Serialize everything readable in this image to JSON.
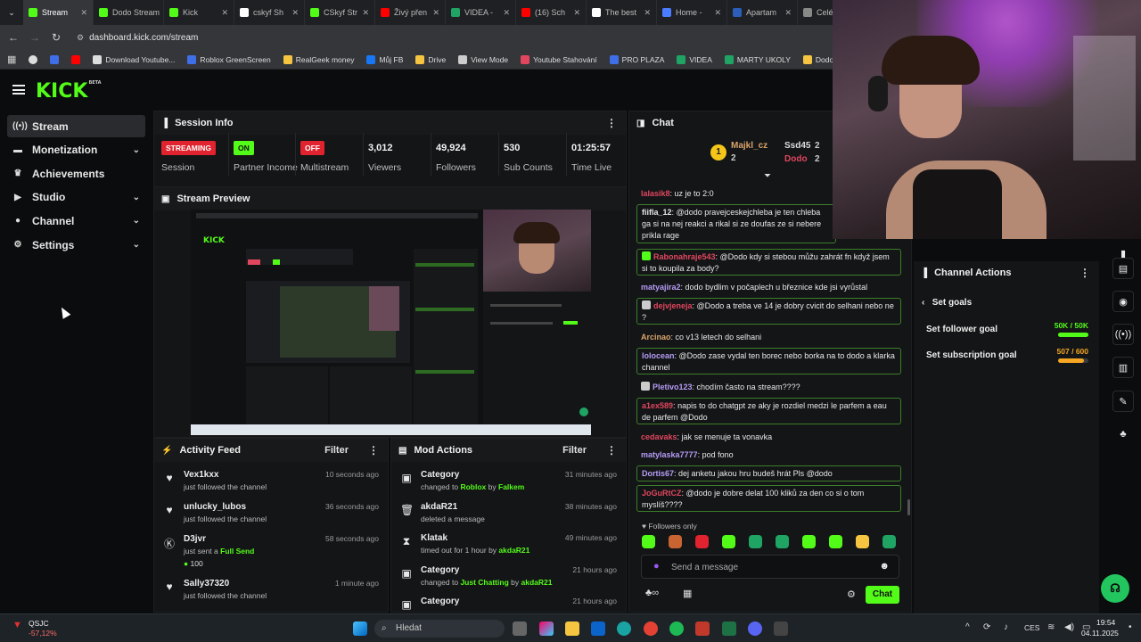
{
  "browser": {
    "tabs": [
      {
        "label": "Stream",
        "color": "#53fc18",
        "active": true
      },
      {
        "label": "Dodo Stream",
        "color": "#53fc18"
      },
      {
        "label": "Kick",
        "color": "#53fc18"
      },
      {
        "label": "cskyf Sh",
        "color": "#ffffff"
      },
      {
        "label": "CSkyf Str",
        "color": "#53fc18"
      },
      {
        "label": "Živý přen",
        "color": "#ff0000"
      },
      {
        "label": "VIDEA -",
        "color": "#1fa463"
      },
      {
        "label": "(16) Sch",
        "color": "#ff0000"
      },
      {
        "label": "The best",
        "color": "#ffffff"
      },
      {
        "label": "Home -",
        "color": "#4a7cff"
      },
      {
        "label": "Apartam",
        "color": "#2b5eb8"
      },
      {
        "label": "Celé",
        "color": "#888888"
      }
    ],
    "url": "dashboard.kick.com/stream",
    "bookmarks": [
      "Download Youtube...",
      "Roblox GreenScreen",
      "RealGeek money",
      "Můj FB",
      "Drive",
      "View Mode",
      "Youtube Stahování",
      "PRO PLAZA",
      "VIDEA",
      "MARTY UKOLY",
      "Dodo videa"
    ]
  },
  "brand": {
    "logo": "KICK",
    "beta": "BETA"
  },
  "sidebar": {
    "items": [
      {
        "label": "Stream",
        "icon": "radio-icon"
      },
      {
        "label": "Monetization",
        "icon": "wallet-icon"
      },
      {
        "label": "Achievements",
        "icon": "trophy-icon"
      },
      {
        "label": "Studio",
        "icon": "camera-icon"
      },
      {
        "label": "Channel",
        "icon": "user-icon"
      },
      {
        "label": "Settings",
        "icon": "gear-icon"
      }
    ]
  },
  "session_info": {
    "title": "Session Info",
    "stats": [
      {
        "value": "STREAMING",
        "label": "Session"
      },
      {
        "value": "ON",
        "label": "Partner Income"
      },
      {
        "value": "OFF",
        "label": "Multistream"
      },
      {
        "value": "3,012",
        "label": "Viewers"
      },
      {
        "value": "49,924",
        "label": "Followers"
      },
      {
        "value": "530",
        "label": "Sub Counts"
      },
      {
        "value": "01:25:57",
        "label": "Time Live"
      }
    ]
  },
  "stream_preview": {
    "title": "Stream Preview"
  },
  "activity_feed": {
    "title": "Activity Feed",
    "filter": "Filter",
    "items": [
      {
        "name": "Vex1kxx",
        "action": "just followed the channel",
        "time": "10 seconds ago"
      },
      {
        "name": "unlucky_lubos",
        "action": "just followed the channel",
        "time": "36 seconds ago"
      },
      {
        "name": "D3jvr",
        "action": "just sent a",
        "highlight": "Full Send",
        "amount": "100",
        "time": "58 seconds ago"
      },
      {
        "name": "Sally37320",
        "action": "just followed the channel",
        "time": "1 minute ago"
      }
    ]
  },
  "mod_actions": {
    "title": "Mod Actions",
    "filter": "Filter",
    "items": [
      {
        "name": "Category",
        "pre": "changed to",
        "target": "Roblox",
        "mid": "by",
        "by": "Falkem",
        "time": "31 minutes ago"
      },
      {
        "name": "akdaR21",
        "pre": "deleted a message",
        "time": "38 minutes ago"
      },
      {
        "name": "Klatak",
        "pre": "timed out for 1 hour by",
        "by": "akdaR21",
        "time": "49 minutes ago"
      },
      {
        "name": "Category",
        "pre": "changed to",
        "target": "Just Chatting",
        "mid": "by",
        "by": "akdaR21",
        "time": "21 hours ago"
      },
      {
        "name": "Category",
        "time": "21 hours ago"
      }
    ]
  },
  "chat": {
    "title": "Chat",
    "top": {
      "rank": "1",
      "user1": "Majkl_cz",
      "count1": "2",
      "user2": "Ssd45",
      "count2": "2",
      "user3": "Dodo",
      "count3": "2"
    },
    "messages": [
      {
        "user": "lalasik8",
        "color": "#e0475f",
        "text": "uz je to 2:0"
      },
      {
        "user": "fiifla_12",
        "color": "#e6e6e6",
        "text": "@dodo pravejceskejchleba je ten chleba ga si na nej reakci a rikal si ze doufas ze si nebere prikla rage"
      },
      {
        "user": "Rabonahraje543",
        "color": "#e0475f",
        "text": "@Dodo kdy si stebou můžu zahrát fn když jsem si to koupila za body?"
      },
      {
        "user": "matyajira2",
        "color": "#b59cf5",
        "text": "dodo bydlim v počaplech u březnice kde jsi vyrůstal"
      },
      {
        "user": "dejvjeneja",
        "color": "#e0475f",
        "text": "@Dodo a treba ve 14 je dobry cvicit do selhani nebo ne ?"
      },
      {
        "user": "Arcinao",
        "color": "#d9a46a",
        "text": "co v13 letech do selhani"
      },
      {
        "user": "lolocean",
        "color": "#b59cf5",
        "text": "@Dodo zase vydal ten borec nebo borka na to dodo a klarka channel"
      },
      {
        "user": "Pletivo123",
        "color": "#b59cf5",
        "text": "chodím často na stream????"
      },
      {
        "user": "a1ex589",
        "color": "#e0475f",
        "text": "napis to do chatgpt ze aky je rozdiel medzi le parfem a eau de parfem @Dodo"
      },
      {
        "user": "cedavaks",
        "color": "#e0475f",
        "text": "jak se menuje ta vonavka"
      },
      {
        "user": "matylaska7777",
        "color": "#b59cf5",
        "text": "pod fono"
      },
      {
        "user": "Dortis67",
        "color": "#b59cf5",
        "text": "dej anketu jakou hru budeš hrát Pls @dodo"
      },
      {
        "user": "JoGuRtCZ",
        "color": "#e0475f",
        "text": "@dodo je dobre delat 100 kliků za den co si o tom myslíš????"
      }
    ],
    "followers_only": "Followers only",
    "placeholder": "Send a message",
    "send": "Chat"
  },
  "channel_actions": {
    "title": "Channel Actions",
    "back": "Set goals",
    "goals": [
      {
        "label": "Set follower goal",
        "value": "50K / 50K",
        "progress": 1.0,
        "color": "#53fc18"
      },
      {
        "label": "Set subscription goal",
        "value": "507 / 600",
        "progress": 0.845,
        "color": "#f5a623"
      }
    ]
  },
  "taskbar": {
    "stock": {
      "name": "QSJC",
      "change": "-57,12%"
    },
    "search": "Hledat",
    "lang": "CES",
    "time": "19:54",
    "date": "04.11.2025"
  }
}
